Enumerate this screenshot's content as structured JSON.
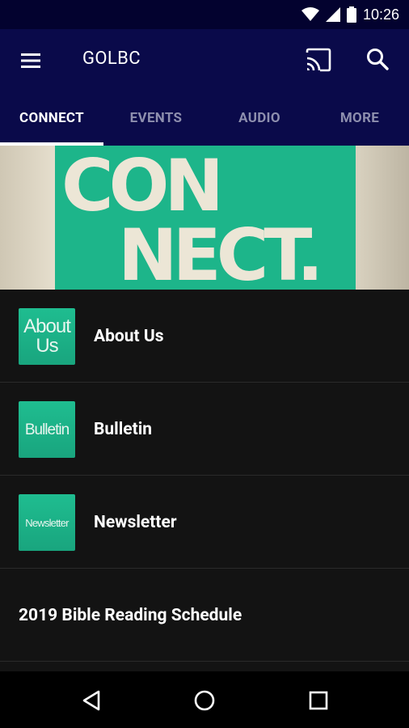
{
  "status": {
    "time": "10:26"
  },
  "appbar": {
    "title": "GOLBC"
  },
  "tabs": [
    "CONNECT",
    "EVENTS",
    "AUDIO",
    "MORE"
  ],
  "banner": {
    "line1": "CON",
    "line2": "NECT."
  },
  "list": [
    {
      "label": "About Us",
      "thumb_line1": "About",
      "thumb_line2": "Us"
    },
    {
      "label": "Bulletin",
      "thumb_line1": "Bulletin"
    },
    {
      "label": "Newsletter",
      "thumb_line1": "Newsletter"
    },
    {
      "label": "2019 Bible Reading Schedule"
    }
  ],
  "colors": {
    "appbar": "#0a0a4a",
    "accent": "#1db58a",
    "list_bg": "#131313"
  }
}
